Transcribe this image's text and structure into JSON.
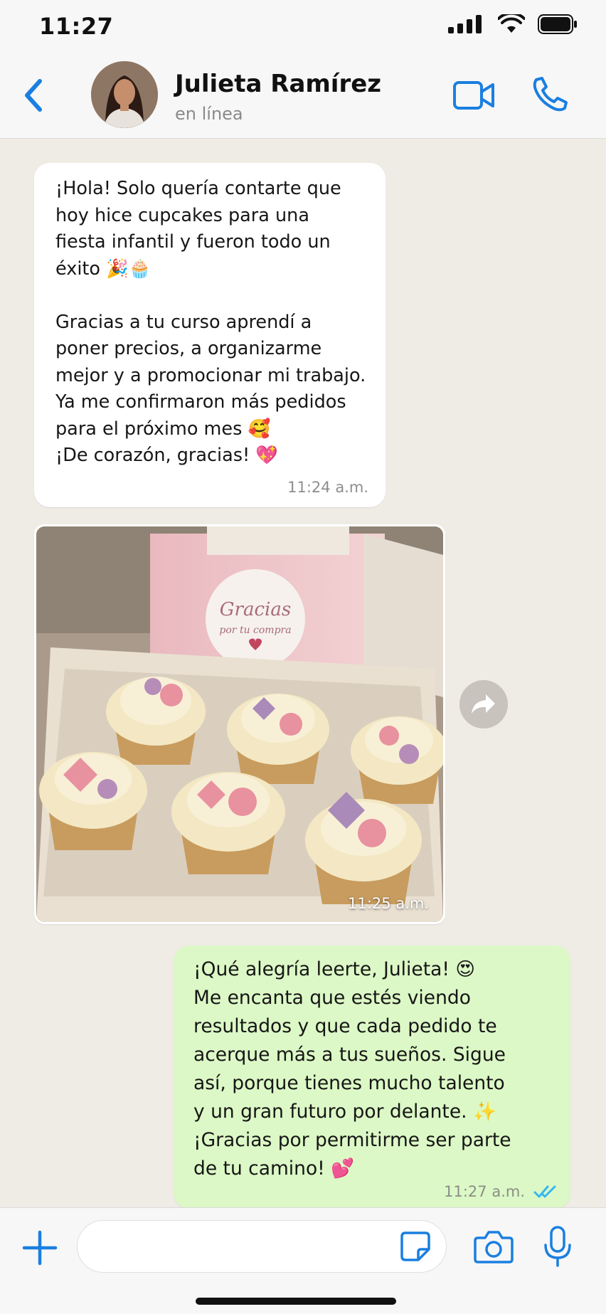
{
  "status_bar": {
    "time": "11:27"
  },
  "header": {
    "contact_name": "Julieta Ramírez",
    "contact_status": "en línea"
  },
  "messages": [
    {
      "direction": "incoming",
      "type": "text",
      "text": "¡Hola! Solo quería contarte que\nhoy hice cupcakes para una\nfiesta infantil y fueron todo un\néxito 🎉🧁\n\nGracias a tu curso aprendí a\nponer precios, a organizarme\nmejor y a promocionar mi trabajo.\nYa me confirmaron más pedidos\npara el próximo mes 🥰\n¡De corazón, gracias! 💖",
      "time": "11:24 a.m."
    },
    {
      "direction": "incoming",
      "type": "image",
      "sticker_line1": "Gracias",
      "sticker_line2": "por tu compra",
      "time": "11:25 a.m."
    },
    {
      "direction": "outgoing",
      "type": "text",
      "text": "¡Qué alegría leerte, Julieta! 😍\nMe encanta que estés viendo\nresultados y que cada pedido te\nacerque más a tus sueños. Sigue\nasí, porque tienes mucho talento\ny un gran futuro por delante. ✨\n¡Gracias por permitirme ser parte\nde tu camino! 💕",
      "time": "11:27 a.m.",
      "read": true
    }
  ],
  "input": {
    "placeholder": ""
  },
  "colors": {
    "accent": "#1a7fe0",
    "incoming_bubble": "#ffffff",
    "outgoing_bubble": "#dcf8c6",
    "chat_background": "#efebe5",
    "read_ticks": "#34b7f1"
  },
  "icons": {
    "back": "chevron-left-icon",
    "video": "video-camera-icon",
    "call": "phone-icon",
    "forward": "forward-arrow-icon",
    "plus": "plus-icon",
    "sticker": "sticker-icon",
    "camera": "camera-icon",
    "mic": "microphone-icon"
  }
}
